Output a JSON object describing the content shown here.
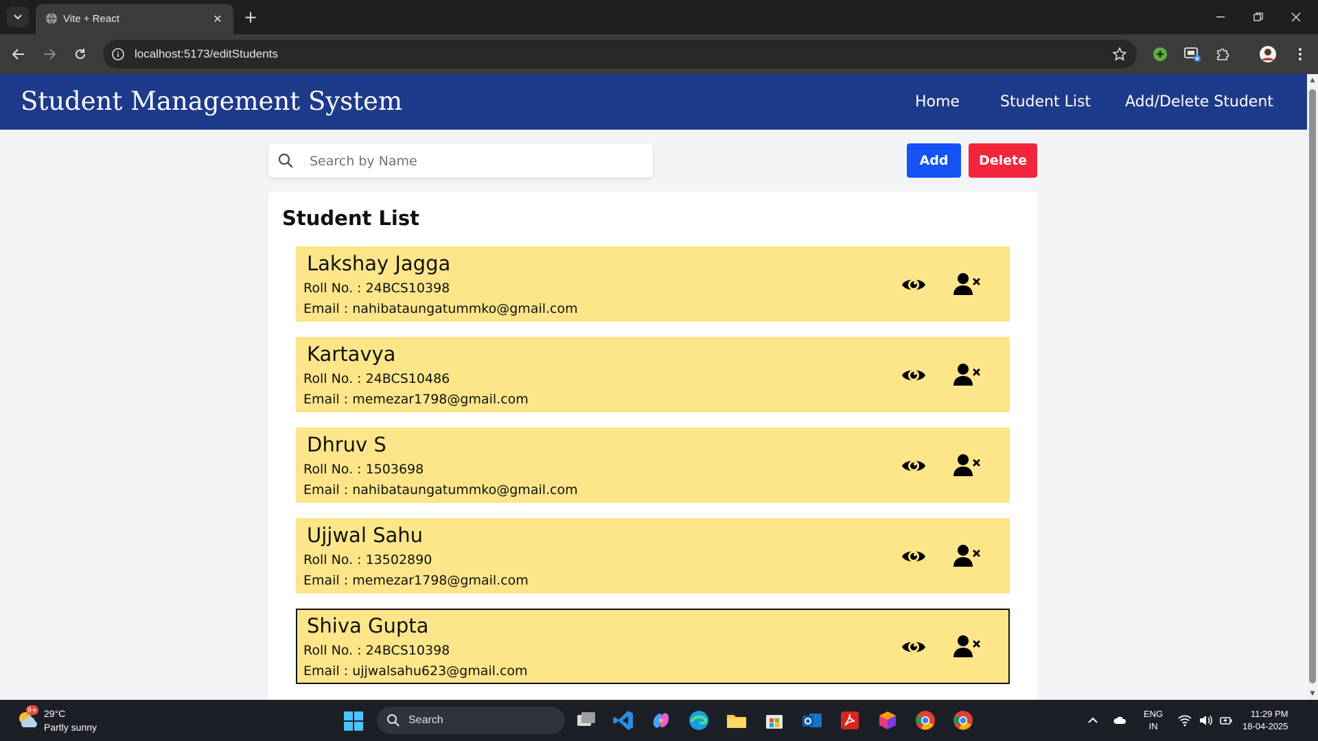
{
  "browser": {
    "tab_title": "Vite + React",
    "url": "localhost:5173/editStudents"
  },
  "header": {
    "title": "Student Management System",
    "nav": [
      "Home",
      "Student List",
      "Add/Delete Student"
    ]
  },
  "search": {
    "placeholder": "Search by Name",
    "value": ""
  },
  "actions": {
    "add_label": "Add",
    "delete_label": "Delete"
  },
  "list": {
    "title": "Student List",
    "roll_prefix": "Roll No. : ",
    "email_prefix": "Email : ",
    "students": [
      {
        "name": "Lakshay Jagga",
        "roll": "24BCS10398",
        "email": "nahibataungatummko@gmail.com"
      },
      {
        "name": "Kartavya",
        "roll": "24BCS10486",
        "email": "memezar1798@gmail.com"
      },
      {
        "name": "Dhruv S",
        "roll": "1503698",
        "email": "nahibataungatummko@gmail.com"
      },
      {
        "name": "Ujjwal Sahu",
        "roll": "13502890",
        "email": "memezar1798@gmail.com"
      },
      {
        "name": "Shiva Gupta",
        "roll": "24BCS10398",
        "email": "ujjwalsahu623@gmail.com"
      }
    ],
    "selected_index": 4
  },
  "taskbar": {
    "weather_badge": "9+",
    "temperature": "29°C",
    "weather": "Partly sunny",
    "search_label": "Search",
    "language": "ENG",
    "region": "IN",
    "time": "11:29 PM",
    "date": "18-04-2025"
  },
  "colors": {
    "header_bg": "#1e3a8a",
    "add_button": "#1553f5",
    "delete_button": "#f2253d",
    "student_row": "#fde68a"
  }
}
